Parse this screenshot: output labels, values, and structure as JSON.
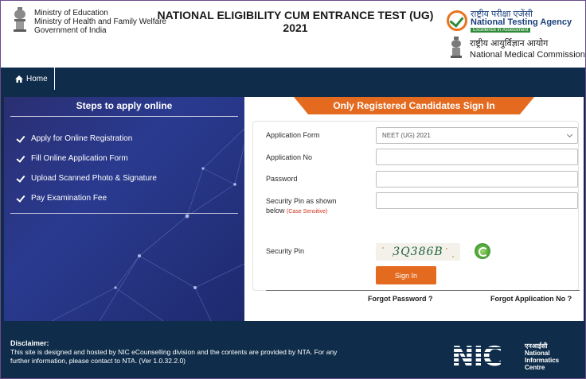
{
  "header": {
    "ministry_lines": [
      "Ministry of Education",
      "Ministry of Health and Family Welfare",
      "Government of India"
    ],
    "title_line1": "NATIONAL ELIGIBILITY CUM ENTRANCE TEST (UG)",
    "title_line2": "2021",
    "nta_hindi": "राष्ट्रीय परीक्षा एजेंसी",
    "nta_name": "National Testing Agency",
    "nta_tagline": "Excellence in Assessment",
    "nmc_hindi": "राष्ट्रीय आयुर्विज्ञान आयोग",
    "nmc_name": "National Medical Commission"
  },
  "nav": {
    "home_label": "Home"
  },
  "left_panel": {
    "title": "Steps to apply online",
    "steps": [
      "Apply for Online Registration",
      "Fill Online Application Form",
      "Upload Scanned Photo & Signature",
      "Pay Examination Fee"
    ]
  },
  "sign_in": {
    "tab_title": "Only Registered Candidates Sign In",
    "application_form_label": "Application Form",
    "application_form_value": "NEET (UG) 2021",
    "application_no_label": "Application No",
    "application_no_value": "",
    "password_label": "Password",
    "password_value": "",
    "security_pin_shown_label": "Security Pin as shown",
    "security_pin_shown_label2": "below",
    "case_sensitive_note": "(Case Sensitive)",
    "security_pin_shown_value": "",
    "security_pin_label": "Security Pin",
    "captcha_text": "3Q386B",
    "sign_in_button": "Sign In",
    "forgot_password": "Forgot Password ?",
    "forgot_application_no": "Forgot Application No ?"
  },
  "footer": {
    "disclaimer_title": "Disclaimer:",
    "disclaimer_line1": "This site is designed and hosted by NIC eCounselling division and the contents are provided by NTA. For any",
    "disclaimer_line2": "further information, please contact to NTA. (Ver 1.0.32.2.0)",
    "nic_logo": "NIC",
    "nic_hindi": "एनआईसी",
    "nic_line2": "National",
    "nic_line3": "Informatics",
    "nic_line4": "Centre"
  },
  "colors": {
    "navy": "#0f2d4a",
    "accent_orange": "#e36a1e",
    "panel_blue": "#2a3a8f"
  },
  "icons": {
    "home": "home-icon",
    "step": "check-icon",
    "refresh": "refresh-icon",
    "dropdown": "chevron-down-icon"
  }
}
